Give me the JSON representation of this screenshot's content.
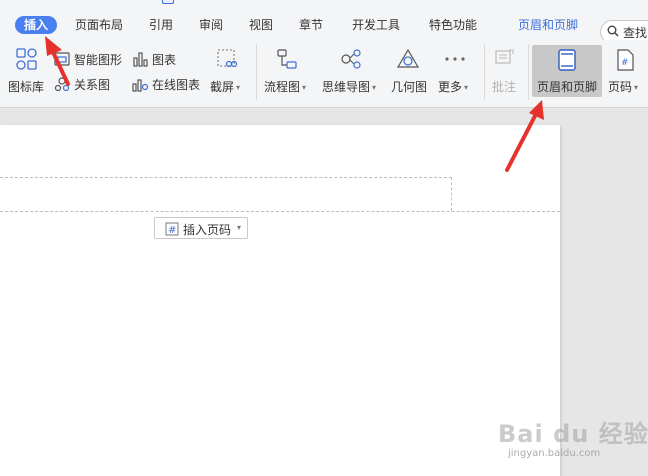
{
  "tabs": [
    {
      "label": "插入",
      "active": true
    },
    {
      "label": "页面布局"
    },
    {
      "label": "引用"
    },
    {
      "label": "审阅"
    },
    {
      "label": "视图"
    },
    {
      "label": "章节"
    },
    {
      "label": "开发工具"
    },
    {
      "label": "特色功能"
    },
    {
      "label": "页眉和页脚",
      "highlight": true
    }
  ],
  "search": {
    "label": "查找"
  },
  "ribbon": {
    "icon_library": "图标库",
    "smart_shape": "智能图形",
    "relation_chart": "关系图",
    "chart": "图表",
    "online_chart": "在线图表",
    "screenshot": "截屏",
    "flowchart": "流程图",
    "mindmap": "思维导图",
    "geometry": "几何图",
    "more": "更多",
    "comment": "批注",
    "header_footer": "页眉和页脚",
    "page_number": "页码"
  },
  "document": {
    "insert_page_number": "插入页码"
  },
  "watermark": {
    "logo": "Bai du 经验",
    "url": "jingyan.baidu.com"
  },
  "colors": {
    "accent": "#4a7ff0",
    "highlight_text": "#3b6fd8",
    "arrow": "#e5322d"
  }
}
